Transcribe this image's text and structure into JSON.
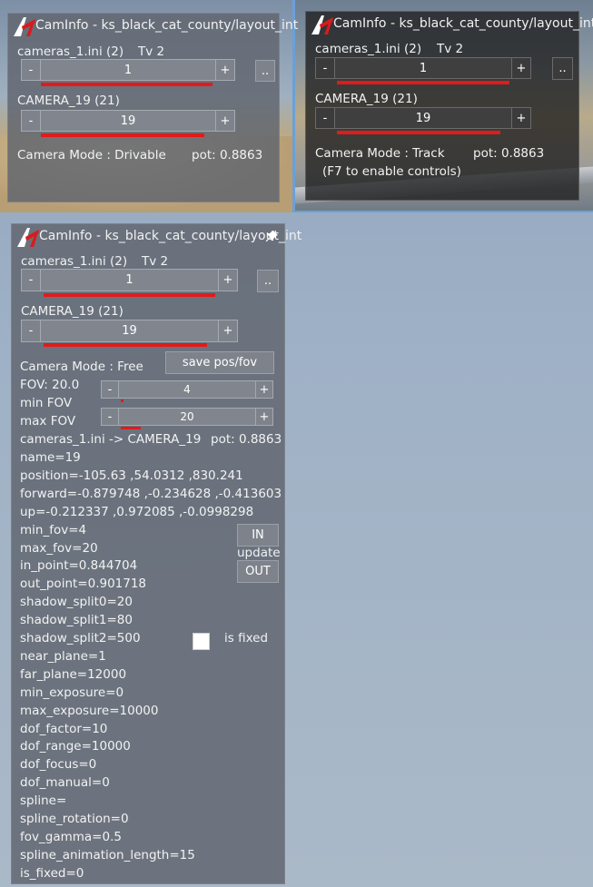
{
  "colors": {
    "accent_red": "#e11b1b",
    "panel_gray": "#5f646e",
    "panel_dark": "#1e1e1e"
  },
  "panel1": {
    "title": "CamInfo - ks_black_cat_county/layout_int",
    "file_label": "cameras_1.ini (2)",
    "tv_label": "Tv 2",
    "stepper1_value": "1",
    "more_label": "..",
    "camera_label": "CAMERA_19 (21)",
    "stepper2_value": "19",
    "mode_text": "Camera Mode : Drivable",
    "pot_text": "pot: 0.8863",
    "minus": "-",
    "plus": "+"
  },
  "panel2": {
    "title": "CamInfo - ks_black_cat_county/layout_int",
    "file_label": "cameras_1.ini (2)",
    "tv_label": "Tv 2",
    "stepper1_value": "1",
    "more_label": "..",
    "camera_label": "CAMERA_19 (21)",
    "stepper2_value": "19",
    "mode_text": "Camera Mode : Track",
    "pot_text": "pot: 0.8863",
    "hint_text": "(F7 to enable controls)",
    "minus": "-",
    "plus": "+"
  },
  "panel3": {
    "title": "CamInfo - ks_black_cat_county/layout_int",
    "file_label": "cameras_1.ini (2)",
    "tv_label": "Tv 2",
    "stepper1_value": "1",
    "more_label": "..",
    "camera_label": "CAMERA_19 (21)",
    "stepper2_value": "19",
    "mode_text": "Camera Mode : Free",
    "save_label": "save pos/fov",
    "fov_label": "FOV: 20.0",
    "min_fov_label": "min FOV",
    "min_fov_value": "4",
    "max_fov_label": "max FOV",
    "max_fov_value": "20",
    "path_text": "cameras_1.ini -> CAMERA_19",
    "pot_text": "pot: 0.8863",
    "in_label": "IN",
    "update_label": "update",
    "out_label": "OUT",
    "is_fixed_label": "is fixed",
    "minus": "-",
    "plus": "+",
    "props": [
      "name=19",
      "position=-105.63 ,54.0312 ,830.241",
      "forward=-0.879748 ,-0.234628 ,-0.413603",
      "up=-0.212337 ,0.972085 ,-0.0998298",
      "min_fov=4",
      "max_fov=20",
      "in_point=0.844704",
      "out_point=0.901718",
      "shadow_split0=20",
      "shadow_split1=80",
      "shadow_split2=500",
      "near_plane=1",
      "far_plane=12000",
      "min_exposure=0",
      "max_exposure=10000",
      "dof_factor=10",
      "dof_range=10000",
      "dof_focus=0",
      "dof_manual=0",
      "spline=",
      "spline_rotation=0",
      "fov_gamma=0.5",
      "spline_animation_length=15",
      "is_fixed=0"
    ]
  }
}
